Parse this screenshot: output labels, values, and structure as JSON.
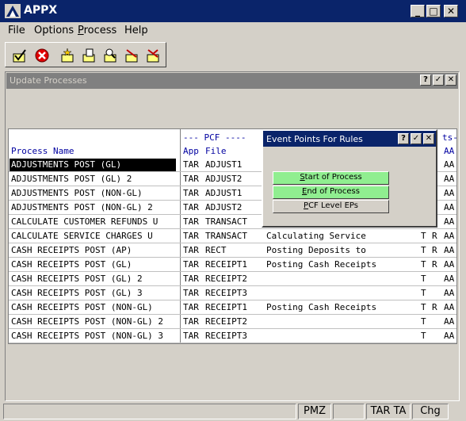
{
  "window": {
    "title": "APPX"
  },
  "menu": {
    "file": "File",
    "options": "Options",
    "process_p": "P",
    "process_rest": "rocess",
    "help": "Help"
  },
  "toolbar": {
    "icons": [
      "check-icon",
      "cancel-icon",
      "new-icon",
      "open-icon",
      "find-icon",
      "prev-icon",
      "next-icon"
    ]
  },
  "mdi": {
    "title": "Update Processes"
  },
  "grid": {
    "header_pcf": "--- PCF ----",
    "header_ts": "ts-",
    "col_process": "Process Name",
    "col_app": "App",
    "col_file": "File",
    "col_aa": "AA",
    "rows": [
      {
        "name": "ADJUSTMENTS POST (GL)",
        "app": "TAR",
        "file": "ADJUST1",
        "desc": "",
        "t": "",
        "r": "",
        "aa": "AA"
      },
      {
        "name": "ADJUSTMENTS POST (GL) 2",
        "app": "TAR",
        "file": "ADJUST2",
        "desc": "",
        "t": "",
        "r": "",
        "aa": "AA"
      },
      {
        "name": "ADJUSTMENTS POST (NON-GL)",
        "app": "TAR",
        "file": "ADJUST1",
        "desc": "",
        "t": "",
        "r": "",
        "aa": "AA"
      },
      {
        "name": "ADJUSTMENTS POST (NON-GL) 2",
        "app": "TAR",
        "file": "ADJUST2",
        "desc": "",
        "t": "",
        "r": "",
        "aa": "AA"
      },
      {
        "name": "CALCULATE CUSTOMER REFUNDS U",
        "app": "TAR",
        "file": "TRANSACT",
        "desc": "",
        "t": "",
        "r": "",
        "aa": "AA"
      },
      {
        "name": "CALCULATE SERVICE CHARGES U",
        "app": "TAR",
        "file": "TRANSACT",
        "desc": "Calculating Service",
        "t": "T",
        "r": "R",
        "aa": "AA"
      },
      {
        "name": "CASH RECEIPTS POST (AP)",
        "app": "TAR",
        "file": "RECT",
        "desc": "Posting Deposits to",
        "t": "T",
        "r": "R",
        "aa": "AA"
      },
      {
        "name": "CASH RECEIPTS POST (GL)",
        "app": "TAR",
        "file": "RECEIPT1",
        "desc": "Posting Cash Receipts",
        "t": "T",
        "r": "R",
        "aa": "AA"
      },
      {
        "name": "CASH RECEIPTS POST (GL) 2",
        "app": "TAR",
        "file": "RECEIPT2",
        "desc": "",
        "t": "T",
        "r": "",
        "aa": "AA"
      },
      {
        "name": "CASH RECEIPTS POST (GL) 3",
        "app": "TAR",
        "file": "RECEIPT3",
        "desc": "",
        "t": "T",
        "r": "",
        "aa": "AA"
      },
      {
        "name": "CASH RECEIPTS POST (NON-GL)",
        "app": "TAR",
        "file": "RECEIPT1",
        "desc": "Posting Cash Receipts",
        "t": "T",
        "r": "R",
        "aa": "AA"
      },
      {
        "name": "CASH RECEIPTS POST (NON-GL) 2",
        "app": "TAR",
        "file": "RECEIPT2",
        "desc": "",
        "t": "T",
        "r": "",
        "aa": "AA"
      },
      {
        "name": "CASH RECEIPTS POST (NON-GL) 3",
        "app": "TAR",
        "file": "RECEIPT3",
        "desc": "",
        "t": "T",
        "r": "",
        "aa": "AA"
      }
    ]
  },
  "popup": {
    "title": "Event Points For Rules",
    "btn_start_u": "S",
    "btn_start_rest": "tart of Process",
    "btn_end_u": "E",
    "btn_end_rest": "nd of Process",
    "btn_pcf_u": "P",
    "btn_pcf_rest": "CF Level EPs"
  },
  "status": {
    "p1": "PMZ",
    "p2": "TAR TA",
    "p3": "Chg"
  },
  "colors": {
    "title_bg": "#0a246a",
    "header_text": "#0000a0",
    "green_btn": "#90ee90"
  }
}
